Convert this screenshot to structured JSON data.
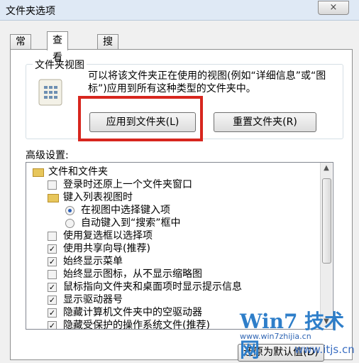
{
  "window": {
    "title": "文件夹选项",
    "close_glyph": "×"
  },
  "tabs": [
    {
      "label": "常规"
    },
    {
      "label": "查看"
    },
    {
      "label": "搜索"
    }
  ],
  "folder_view": {
    "section_title": "文件夹视图",
    "description": "可以将该文件夹正在使用的视图(例如“详细信息”或“图标”)应用到所有这种类型的文件夹中。",
    "apply_button": "应用到文件夹(L)",
    "reset_button": "重置文件夹(R)"
  },
  "advanced": {
    "label": "高级设置:",
    "items": [
      {
        "kind": "folder",
        "text": "文件和文件夹"
      },
      {
        "kind": "checkbox",
        "checked": false,
        "text": "登录时还原上一个文件夹窗口"
      },
      {
        "kind": "folder",
        "text": "键入列表视图时"
      },
      {
        "kind": "radio",
        "checked": true,
        "text": "在视图中选择键入项"
      },
      {
        "kind": "radio",
        "checked": false,
        "text": "自动键入到“搜索”框中"
      },
      {
        "kind": "checkbox",
        "checked": false,
        "text": "使用复选框以选择项"
      },
      {
        "kind": "checkbox",
        "checked": true,
        "text": "使用共享向导(推荐)"
      },
      {
        "kind": "checkbox",
        "checked": true,
        "text": "始终显示菜单"
      },
      {
        "kind": "checkbox",
        "checked": false,
        "text": "始终显示图标，从不显示缩略图"
      },
      {
        "kind": "checkbox",
        "checked": true,
        "text": "鼠标指向文件夹和桌面项时显示提示信息"
      },
      {
        "kind": "checkbox",
        "checked": true,
        "text": "显示驱动器号"
      },
      {
        "kind": "checkbox",
        "checked": true,
        "text": "隐藏计算机文件夹中的空驱动器"
      },
      {
        "kind": "checkbox",
        "checked": true,
        "text": "隐藏受保护的操作系统文件(推荐)"
      }
    ]
  },
  "buttons": {
    "restore_defaults": "还原为默认值(D)"
  },
  "watermark": {
    "logo": "Win7 技术网",
    "url_top": "www.win7zhijia.cn",
    "url_bottom": "www.itjs.cn"
  }
}
